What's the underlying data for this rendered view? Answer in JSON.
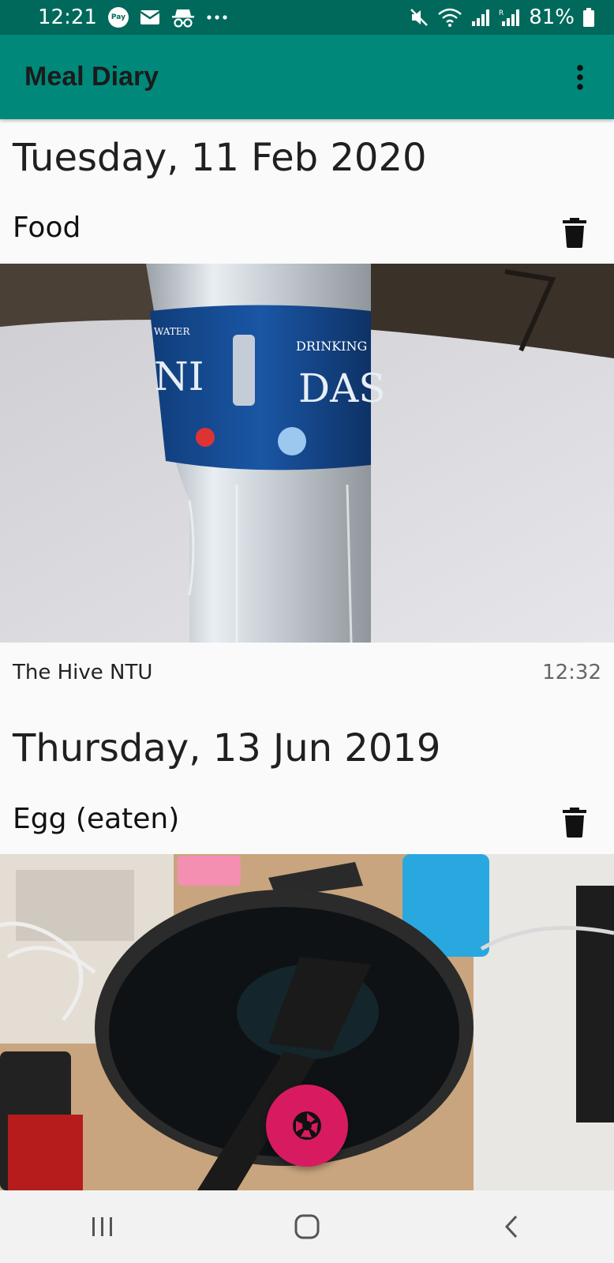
{
  "status_bar": {
    "time": "12:21",
    "pay_label": "Pay",
    "battery": "81%",
    "icons": [
      "pay-icon",
      "mail-icon",
      "incognito-icon",
      "more-dots-icon",
      "mute-icon",
      "wifi-icon",
      "signal-icon",
      "signal-roaming-icon",
      "battery-icon"
    ]
  },
  "app_bar": {
    "title": "Meal Diary",
    "menu_icon": "overflow-menu-icon"
  },
  "entries": [
    {
      "date": "Tuesday, 11 Feb 2020",
      "name": "Food",
      "photo_label": "bottle photo",
      "location": "The Hive NTU",
      "time": "12:32"
    },
    {
      "date": "Thursday, 13 Jun 2019",
      "name": "Egg (eaten)",
      "photo_label": "pan photo"
    }
  ],
  "fab": {
    "icon": "camera-shutter-icon"
  },
  "nav_bar": {
    "icons": [
      "recents-icon",
      "home-icon",
      "back-icon"
    ]
  },
  "colors": {
    "status_bar": "#00695c",
    "app_bar": "#00897b",
    "fab": "#d81b60",
    "background": "#fafafa"
  }
}
